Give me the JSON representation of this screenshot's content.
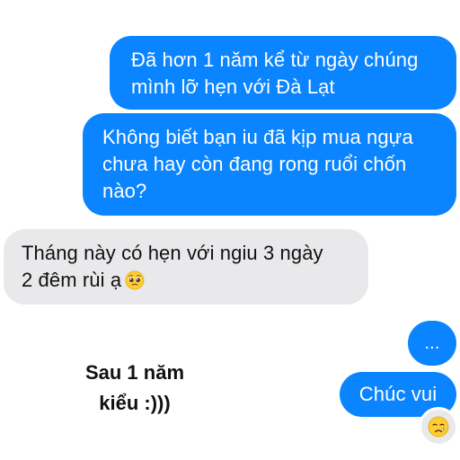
{
  "messages": [
    {
      "line1": "Đã hơn 1 năm kể từ ngày chúng",
      "line2": "mình lỡ hẹn với Đà Lạt"
    },
    {
      "line1": "Không biết bạn iu đã kịp mua ngựa",
      "line2": "chưa hay còn đang rong ruổi chốn",
      "line3": "nào?"
    },
    {
      "line1": "Tháng này có hẹn với ngiu 3 ngày",
      "line2": "2 đêm rùi ạ"
    },
    {
      "text": "..."
    },
    {
      "text": "Chúc vui"
    }
  ],
  "emojis": {
    "pleading": "pleading-face-icon",
    "crying": "crying-face-icon"
  },
  "caption": {
    "line1": "Sau 1 năm",
    "line2": "kiểu :)))"
  },
  "colors": {
    "sent_bubble": "#0a84ff",
    "received_bubble": "#e9e9eb",
    "text_dark": "#111111",
    "text_light": "#ffffff"
  }
}
